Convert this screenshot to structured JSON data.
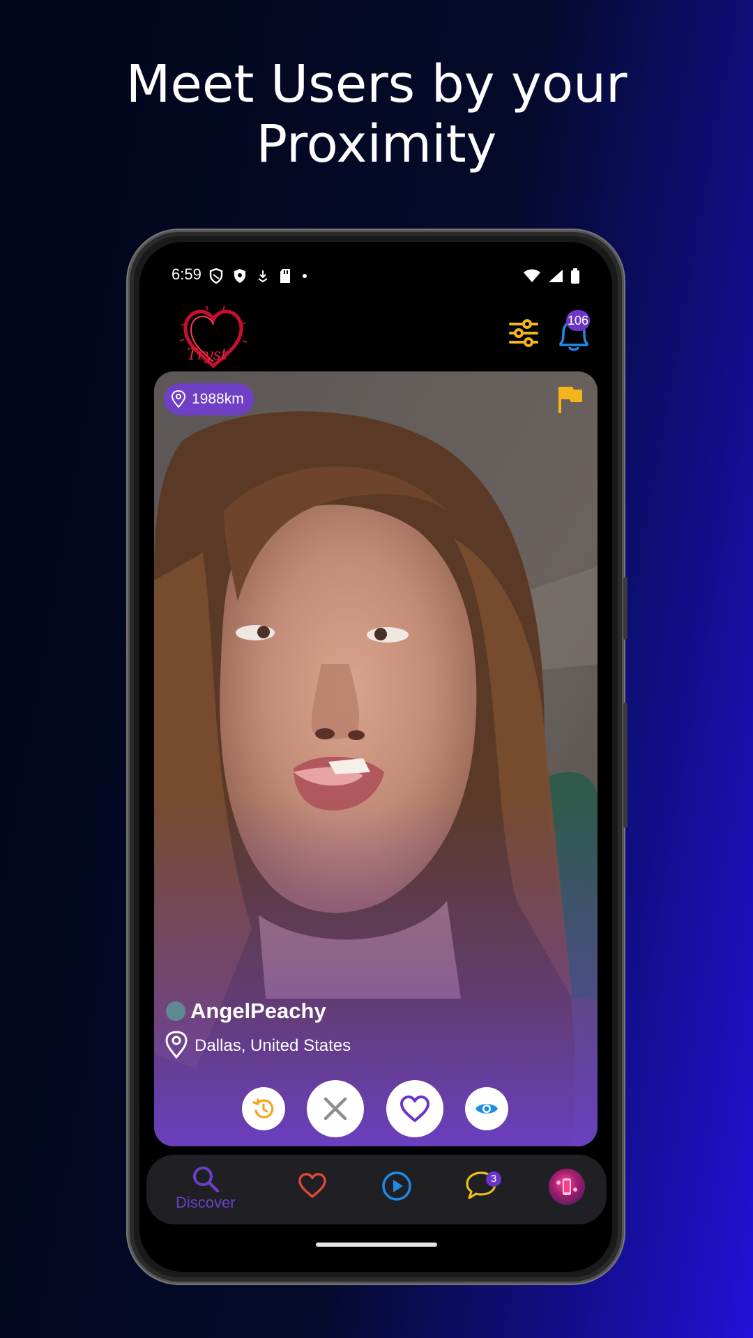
{
  "headline": {
    "line1": "Meet Users by your",
    "line2": "Proximity"
  },
  "status_bar": {
    "time": "6:59"
  },
  "header": {
    "logo_text": "Tryst",
    "notification_count": "106"
  },
  "card": {
    "distance": "1988km",
    "user_name": "AngelPeachy",
    "location": "Dallas, United States"
  },
  "actions": [
    "rewind",
    "pass",
    "like",
    "view-profile"
  ],
  "nav": {
    "discover_label": "Discover",
    "chat_badge": "3"
  },
  "colors": {
    "accent_purple": "#6b35c9",
    "icon_yellow": "#f3b51a",
    "like_red": "#e04a3a",
    "play_blue": "#1f8be6",
    "eye_blue": "#1a8fe8"
  }
}
